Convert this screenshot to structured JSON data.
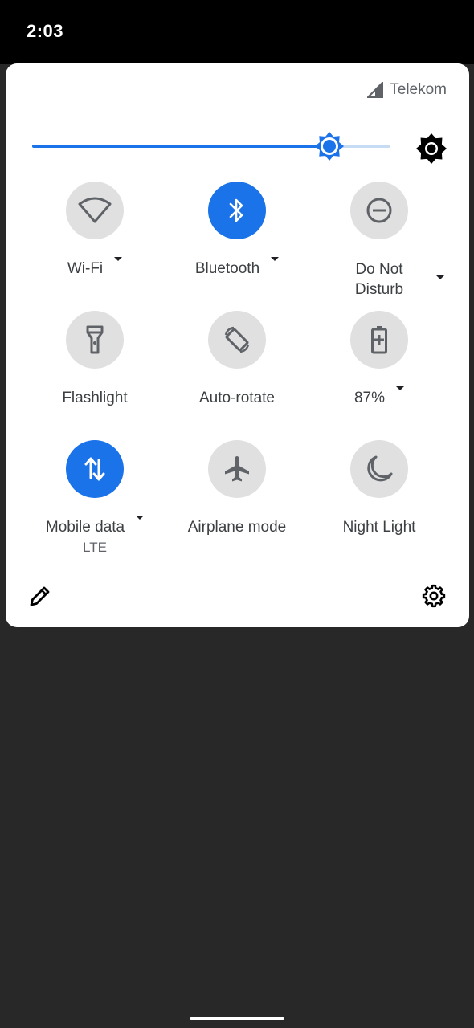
{
  "status_bar": {
    "time": "2:03"
  },
  "carrier": {
    "name": "Telekom",
    "icon": "signal-icon"
  },
  "brightness": {
    "level": 0.83,
    "accent": "#1a73e8",
    "track_color": "#c6dbf4",
    "auto_icon": "auto-brightness-icon"
  },
  "tiles": [
    {
      "label": "Wi-Fi",
      "icon": "wifi-icon",
      "active": false,
      "has_dropdown": true
    },
    {
      "label": "Bluetooth",
      "icon": "bluetooth-icon",
      "active": true,
      "has_dropdown": true
    },
    {
      "label_line1": "Do Not",
      "label_line2": "Disturb",
      "icon": "do-not-disturb-icon",
      "active": false,
      "has_dropdown": true
    },
    {
      "label": "Flashlight",
      "icon": "flashlight-icon",
      "active": false,
      "has_dropdown": false
    },
    {
      "label": "Auto-rotate",
      "icon": "auto-rotate-icon",
      "active": false,
      "has_dropdown": false
    },
    {
      "label": "87%",
      "icon": "battery-saver-icon",
      "active": false,
      "has_dropdown": true
    },
    {
      "label": "Mobile data",
      "sublabel": "LTE",
      "icon": "mobile-data-icon",
      "active": true,
      "has_dropdown": true
    },
    {
      "label": "Airplane mode",
      "icon": "airplane-icon",
      "active": false,
      "has_dropdown": false
    },
    {
      "label": "Night Light",
      "icon": "night-light-icon",
      "active": false,
      "has_dropdown": false
    }
  ],
  "footer": {
    "edit_icon": "pencil-icon",
    "settings_icon": "gear-icon"
  }
}
